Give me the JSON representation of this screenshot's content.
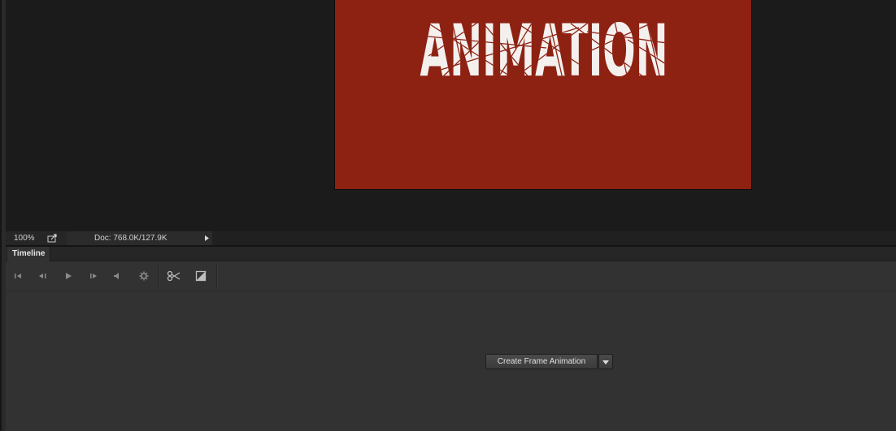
{
  "document": {
    "artwork_text": "ANIMATION",
    "colors": {
      "canvas_background": "#8d2112",
      "text_fill": "#f4f0ee",
      "workspace": "#1b1b1b"
    }
  },
  "statusbar": {
    "zoom": "100%",
    "doc_info": "Doc: 768.0K/127.9K",
    "export_icon": "export-icon",
    "menu_arrow_icon": "triangle-right-icon"
  },
  "timeline": {
    "tab_label": "Timeline",
    "controls": [
      {
        "name": "go-to-first-frame",
        "icon": "skip-to-start-icon"
      },
      {
        "name": "previous-frame",
        "icon": "step-backward-icon"
      },
      {
        "name": "play",
        "icon": "play-icon"
      },
      {
        "name": "next-frame",
        "icon": "step-forward-icon"
      },
      {
        "name": "audio",
        "icon": "speaker-icon"
      },
      {
        "name": "settings",
        "icon": "gear-icon"
      },
      {
        "name": "split",
        "icon": "scissors-icon"
      },
      {
        "name": "transition",
        "icon": "transition-icon"
      }
    ],
    "create_button_label": "Create Frame Animation",
    "create_dropdown_icon": "chevron-down-icon"
  }
}
